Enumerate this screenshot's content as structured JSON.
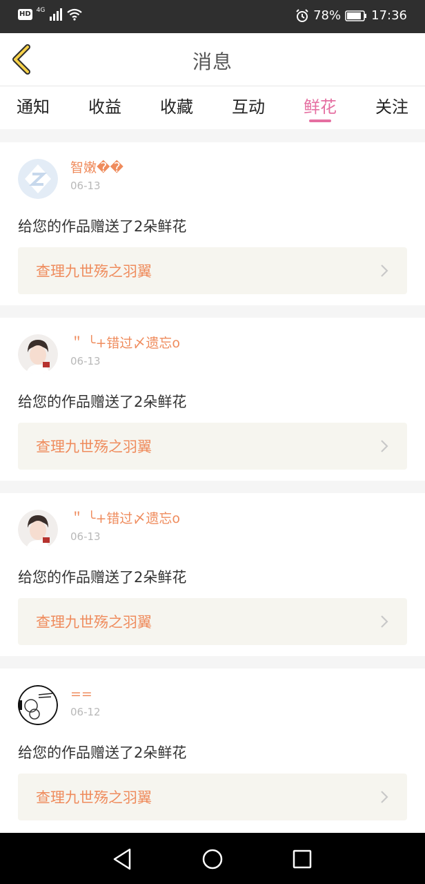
{
  "status_bar": {
    "network": "4G",
    "hd": "HD",
    "battery": "78%",
    "time": "17:36",
    "icons": [
      "hd-icon",
      "signal-icon",
      "wifi-icon",
      "alarm-icon",
      "battery-icon"
    ]
  },
  "header": {
    "title": "消息",
    "back_icon": "chevron-left-icon"
  },
  "tabs": [
    {
      "label": "通知",
      "active": false
    },
    {
      "label": "收益",
      "active": false
    },
    {
      "label": "收藏",
      "active": false
    },
    {
      "label": "互动",
      "active": false
    },
    {
      "label": "鲜花",
      "active": true
    },
    {
      "label": "关注",
      "active": false
    }
  ],
  "messages": [
    {
      "user": "智嫩��",
      "date": "06-13",
      "text": "给您的作品赠送了2朵鲜花",
      "work": "查理九世殇之羽翼",
      "avatar": "z-logo-avatar"
    },
    {
      "user": "＂ ╰+错过〆遗忘o",
      "date": "06-13",
      "text": "给您的作品赠送了2朵鲜花",
      "work": "查理九世殇之羽翼",
      "avatar": "photo-avatar"
    },
    {
      "user": "＂ ╰+错过〆遗忘o",
      "date": "06-13",
      "text": "给您的作品赠送了2朵鲜花",
      "work": "查理九世殇之羽翼",
      "avatar": "photo-avatar"
    },
    {
      "user": "==",
      "date": "06-12",
      "text": "给您的作品赠送了2朵鲜花",
      "work": "查理九世殇之羽翼",
      "avatar": "sketch-avatar"
    }
  ],
  "colors": {
    "accent": "#e56fa1",
    "username": "#ef8b5c",
    "status_bar": "#2f2f2f",
    "link_bg": "#f6f5ef"
  }
}
